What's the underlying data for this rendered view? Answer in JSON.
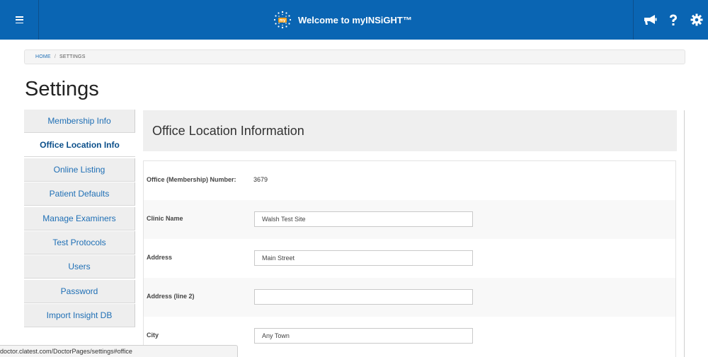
{
  "header": {
    "title": "Welcome to myINSiGHT™",
    "logo_text": "my",
    "brand_color": "#0a65b3",
    "icons": [
      "menu-icon",
      "megaphone-icon",
      "help-icon",
      "gear-icon"
    ]
  },
  "breadcrumb": {
    "home": "HOME",
    "separator": "/",
    "current": "SETTINGS"
  },
  "page": {
    "title": "Settings"
  },
  "sidebar": {
    "items": [
      {
        "label": "Membership Info",
        "active": false
      },
      {
        "label": "Office Location Info",
        "active": true
      },
      {
        "label": "Online Listing",
        "active": false
      },
      {
        "label": "Patient Defaults",
        "active": false
      },
      {
        "label": "Manage Examiners",
        "active": false
      },
      {
        "label": "Test Protocols",
        "active": false
      },
      {
        "label": "Users",
        "active": false
      },
      {
        "label": "Password",
        "active": false
      },
      {
        "label": "Import Insight DB",
        "active": false
      }
    ]
  },
  "panel": {
    "title": "Office Location Information",
    "fields": [
      {
        "label": "Office (Membership) Number:",
        "value": "3679",
        "type": "static"
      },
      {
        "label": "Clinic Name",
        "value": "Walsh Test Site",
        "type": "input"
      },
      {
        "label": "Address",
        "value": "Main Street",
        "type": "input"
      },
      {
        "label": "Address (line 2)",
        "value": "",
        "type": "input"
      },
      {
        "label": "City",
        "value": "Any Town",
        "type": "input"
      }
    ]
  },
  "status_bar": {
    "url": "doctor.clatest.com/DoctorPages/settings#office"
  }
}
